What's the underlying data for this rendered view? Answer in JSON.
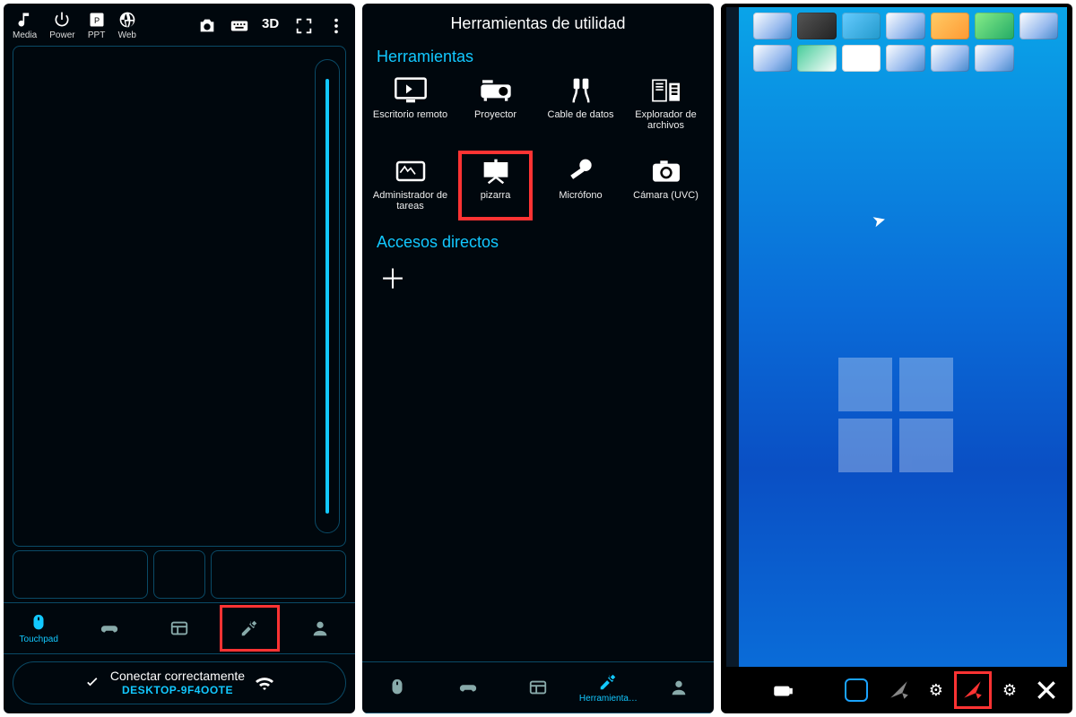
{
  "panel1": {
    "topIcons": [
      {
        "name": "media-icon",
        "label": "Media"
      },
      {
        "name": "power-icon",
        "label": "Power"
      },
      {
        "name": "ppt-icon",
        "label": "PPT"
      },
      {
        "name": "web-icon",
        "label": "Web"
      }
    ],
    "topRight": {
      "threeD": "3D"
    },
    "nav": {
      "touchpad": "Touchpad"
    },
    "connect": {
      "line1": "Conectar correctamente",
      "line2": "DESKTOP-9F4OOTE"
    }
  },
  "panel2": {
    "title": "Herramientas de utilidad",
    "sectionTools": "Herramientas",
    "sectionShortcuts": "Accesos directos",
    "tools": [
      {
        "name": "remote-desktop-icon",
        "label": "Escritorio remoto"
      },
      {
        "name": "projector-icon",
        "label": "Proyector"
      },
      {
        "name": "data-cable-icon",
        "label": "Cable de datos"
      },
      {
        "name": "file-explorer-icon",
        "label": "Explorador de archivos"
      },
      {
        "name": "task-manager-icon",
        "label": "Administrador de tareas"
      },
      {
        "name": "whiteboard-icon",
        "label": "pizarra",
        "highlight": true
      },
      {
        "name": "microphone-icon",
        "label": "Micrófono"
      },
      {
        "name": "camera-uvc-icon",
        "label": "Cámara (UVC)"
      }
    ],
    "navActive": "Herramienta…"
  },
  "panel3": {
    "whiteboardTools": {
      "eraser": "eraser-icon",
      "shape": "shape-tool",
      "pointer": "pointer-tool",
      "pen": "pen-tool",
      "close": "close-icon"
    }
  }
}
